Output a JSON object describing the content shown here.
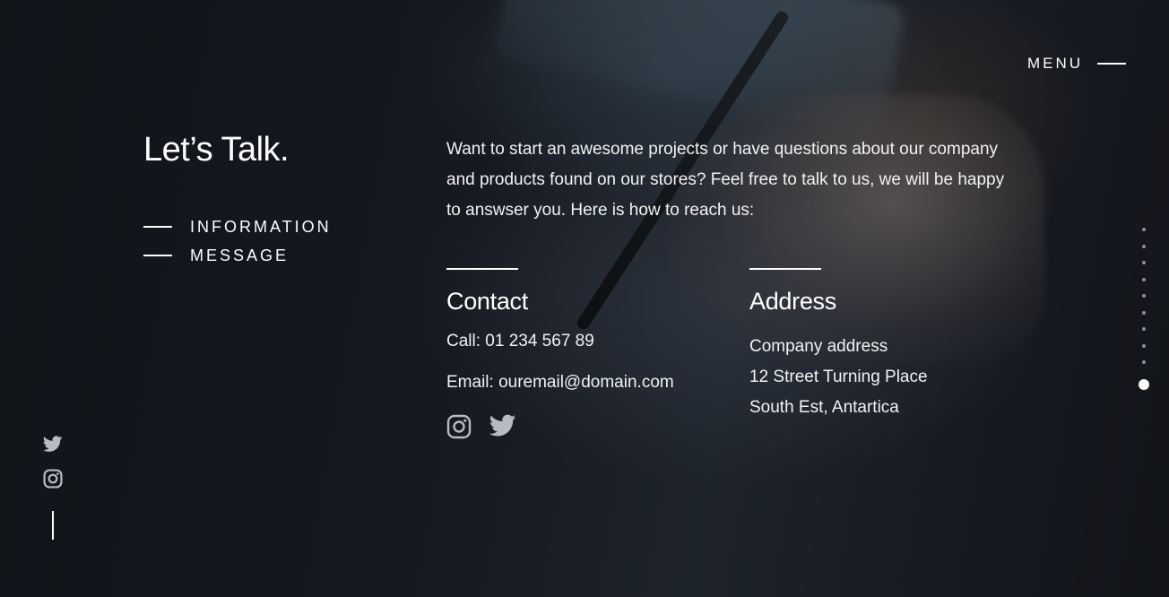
{
  "header": {
    "menu_label": "MENU"
  },
  "page": {
    "title": "Let’s Talk.",
    "nav": [
      {
        "label": "INFORMATION"
      },
      {
        "label": "MESSAGE"
      }
    ],
    "intro": "Want to start an awesome projects or have questions about our company and products found on our stores? Feel free to talk to us, we will be happy to answser you. Here is how to reach us:"
  },
  "contact": {
    "heading": "Contact",
    "call": "Call: 01 234 567 89",
    "email": "Email: ouremail@domain.com",
    "icons": [
      "instagram-icon",
      "twitter-icon"
    ]
  },
  "address": {
    "heading": "Address",
    "lines": [
      "Company address",
      "12 Street Turning Place",
      "South Est, Antartica"
    ]
  },
  "left_socials": [
    "twitter-icon",
    "instagram-icon"
  ],
  "pagination": {
    "dot_count": 10,
    "active_index": 9
  },
  "colors": {
    "background": "#14171d",
    "text": "#ffffff",
    "icon_muted": "#b8bcc2",
    "dot_inactive": "#8a8f96"
  }
}
